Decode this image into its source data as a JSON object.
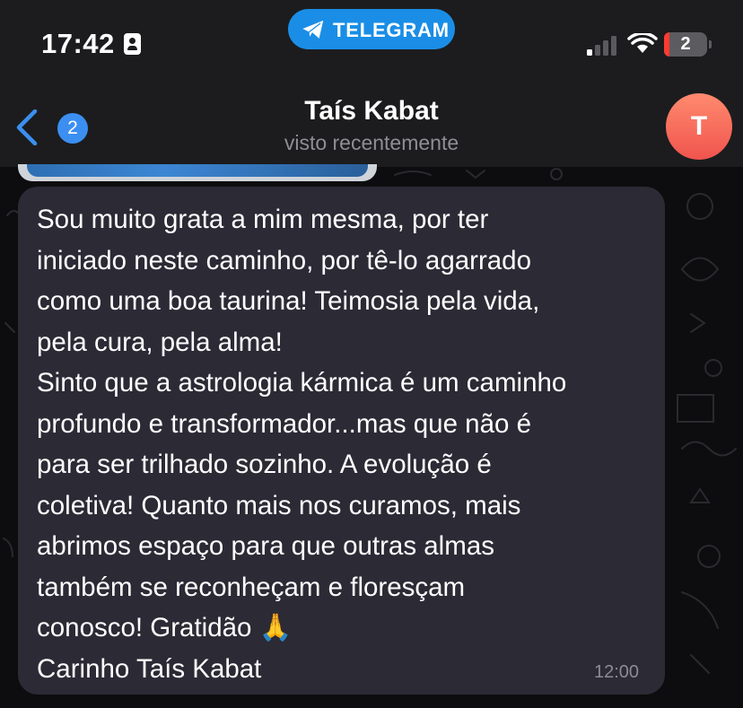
{
  "status_bar": {
    "time": "17:42",
    "badge_label": "TELEGRAM",
    "battery_level": "2"
  },
  "header": {
    "back_count": "2",
    "title": "Taís Kabat",
    "subtitle": "visto recentemente",
    "avatar_initial": "T"
  },
  "message": {
    "text": "Sou muito grata a mim mesma, por ter\niniciado neste caminho, por tê-lo agarrado\ncomo uma boa taurina! Teimosia pela vida,\npela cura, pela alma!\nSinto que a astrologia kármica é um caminho\nprofundo e transformador...mas que não é\npara ser trilhado sozinho. A evolução é\ncoletiva! Quanto mais nos curamos, mais\nabrimos espaço para que outras almas\ntambém se reconheçam e floresçam\nconosco! Gratidão 🙏\nCarinho Taís Kabat",
    "time": "12:00"
  },
  "colors": {
    "accent": "#3b8ff0",
    "telegram_pill": "#1a8ee6",
    "bubble": "#2c2a35",
    "avatar": "#f0544e"
  }
}
